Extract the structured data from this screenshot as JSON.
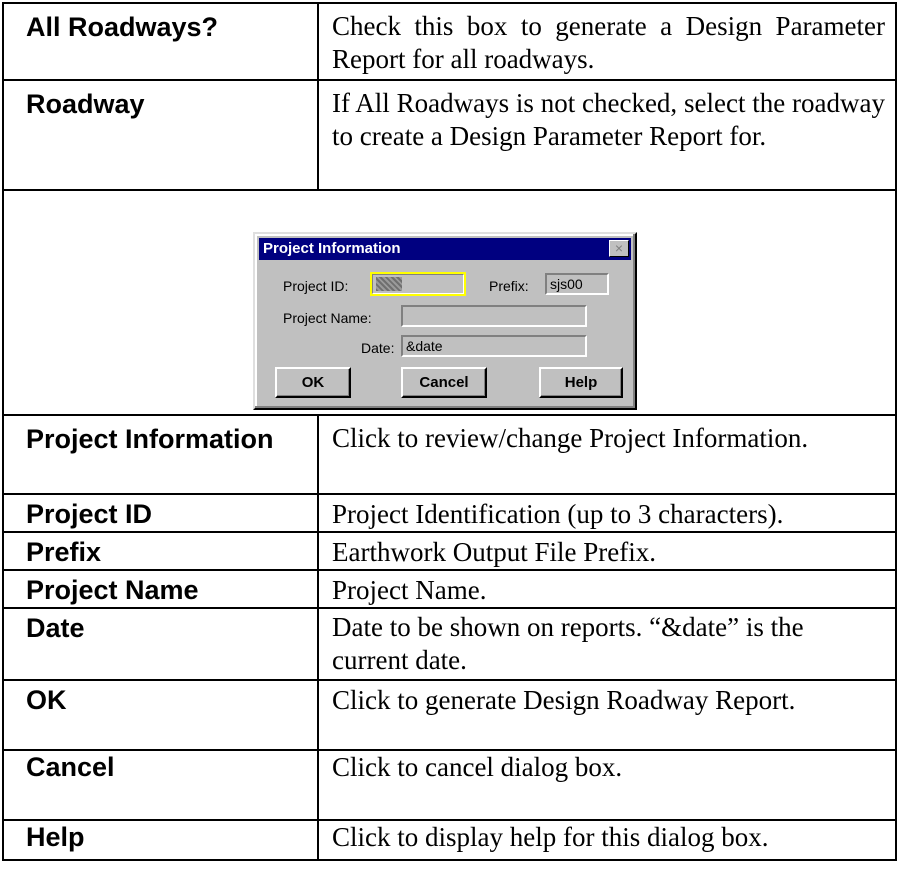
{
  "rows": [
    {
      "term": "All Roadways?",
      "desc": "Check this box to generate a Design Parameter Report for all roadways."
    },
    {
      "term": "Roadway",
      "desc": "If All Roadways is not checked, select the roadway to create a Design Parameter Report for."
    }
  ],
  "dialog": {
    "title": "Project Information",
    "close_glyph": "×",
    "project_id_label": "Project ID:",
    "project_id_value": "",
    "prefix_label": "Prefix:",
    "prefix_value": "sjs00",
    "project_name_label": "Project Name:",
    "project_name_value": "",
    "date_label": "Date:",
    "date_value": "&date",
    "ok_label": "OK",
    "cancel_label": "Cancel",
    "help_label": "Help"
  },
  "rows2": [
    {
      "term": "Project Information",
      "desc": "Click to review/change Project Information."
    },
    {
      "term": "Project ID",
      "desc": "Project Identification (up to 3 characters)."
    },
    {
      "term": "Prefix",
      "desc": "Earthwork Output File Prefix."
    },
    {
      "term": "Project Name",
      "desc": "Project Name."
    },
    {
      "term": "Date",
      "desc": "Date to be shown on reports. “&date” is the current date."
    },
    {
      "term": "OK",
      "desc": "Click to generate Design Roadway Report."
    },
    {
      "term": "Cancel",
      "desc": "Click to cancel dialog box."
    },
    {
      "term": "Help",
      "desc": "Click to display help for this dialog box."
    }
  ]
}
